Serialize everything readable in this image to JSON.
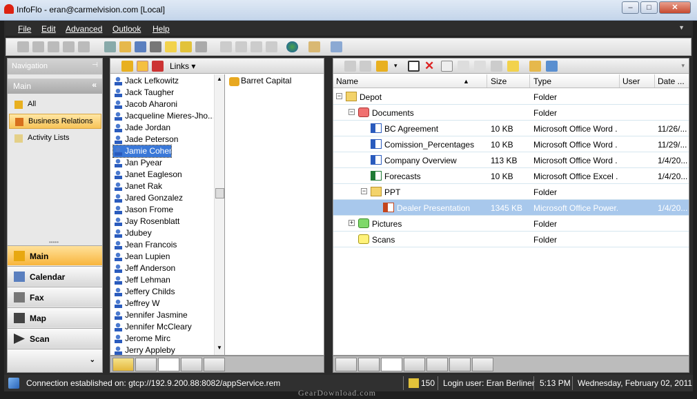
{
  "window": {
    "title": "InfoFlo - eran@carmelvision.com [Local]",
    "minimize": "–",
    "maximize": "□",
    "close": "✕"
  },
  "menu": [
    "File",
    "Edit",
    "Advanced",
    "Outlook",
    "Help"
  ],
  "navigation": {
    "header": "Navigation",
    "section": "Main",
    "items": [
      {
        "label": "All",
        "icon": "org-chart-icon"
      },
      {
        "label": "Business Relations",
        "icon": "people-icon",
        "selected": true
      },
      {
        "label": "Activity Lists",
        "icon": "list-icon"
      }
    ],
    "buttons": [
      {
        "label": "Main",
        "icon": "org-chart-icon",
        "selected": true
      },
      {
        "label": "Calendar",
        "icon": "calendar-icon"
      },
      {
        "label": "Fax",
        "icon": "fax-icon"
      },
      {
        "label": "Map",
        "icon": "map-icon"
      },
      {
        "label": "Scan",
        "icon": "scan-icon"
      }
    ]
  },
  "contacts_pane": {
    "links_label": "Links",
    "contacts": [
      "Jack Lefkowitz",
      "Jack Taugher",
      "Jacob Aharoni",
      "Jacqueline Mieres-Jho...",
      "Jade Jordan",
      "Jade Peterson",
      "Jamie Cohen",
      "Jan Pyear",
      "Janet Eagleson",
      "Janet Rak",
      "Jared Gonzalez",
      "Jason Frome",
      "Jay Rosenblatt",
      "Jdubey",
      "Jean Francois",
      "Jean Lupien",
      "Jeff Anderson",
      "Jeff Lehman",
      "Jeffery Childs",
      "Jeffrey W",
      "Jennifer Jasmine",
      "Jennifer McCleary",
      "Jerome Mirc",
      "Jerry Appleby"
    ],
    "selected_contact": "Jamie Cohen",
    "linked_company": "Barret Capital"
  },
  "documents": {
    "columns": [
      "Name",
      "Size",
      "Type",
      "User",
      "Date ..."
    ],
    "rows": [
      {
        "name": "Depot",
        "size": "",
        "type": "Folder",
        "date": "",
        "level": 0,
        "icon": "folder-icon"
      },
      {
        "name": "Documents",
        "size": "",
        "type": "Folder",
        "date": "",
        "level": 1,
        "icon": "red-folder-icon"
      },
      {
        "name": "BC Agreement",
        "size": "10 KB",
        "type": "Microsoft Office Word ...",
        "date": "11/26/...",
        "level": 2,
        "icon": "word-doc-icon"
      },
      {
        "name": "Comission_Percentages",
        "size": "10 KB",
        "type": "Microsoft Office Word ...",
        "date": "11/29/...",
        "level": 2,
        "icon": "word-doc-icon"
      },
      {
        "name": "Company Overview",
        "size": "113 KB",
        "type": "Microsoft Office Word ...",
        "date": "1/4/20...",
        "level": 2,
        "icon": "word-doc-icon"
      },
      {
        "name": "Forecasts",
        "size": "10 KB",
        "type": "Microsoft Office Excel ...",
        "date": "1/4/20...",
        "level": 2,
        "icon": "excel-doc-icon"
      },
      {
        "name": "PPT",
        "size": "",
        "type": "Folder",
        "date": "",
        "level": 2,
        "icon": "folder-icon"
      },
      {
        "name": "Dealer Presentation",
        "size": "1345 KB",
        "type": "Microsoft Office Power...",
        "date": "1/4/20...",
        "level": 3,
        "icon": "powerpoint-doc-icon",
        "selected": true
      },
      {
        "name": "Pictures",
        "size": "",
        "type": "Folder",
        "date": "",
        "level": 1,
        "icon": "green-folder-icon"
      },
      {
        "name": "Scans",
        "size": "",
        "type": "Folder",
        "date": "",
        "level": 1,
        "icon": "yellow-folder-icon"
      }
    ]
  },
  "status": {
    "connection": "Connection established on: gtcp://192.9.200.88:8082/appService.rem",
    "count": "150",
    "login": "Login user: Eran Berliner",
    "time": "5:13 PM",
    "date": "Wednesday, February 02, 2011"
  },
  "watermark": "GearDownload.com",
  "colors": {
    "accent": "#f8b53d",
    "selection": "#a8c8ec",
    "chrome": "#2b2b2b"
  }
}
